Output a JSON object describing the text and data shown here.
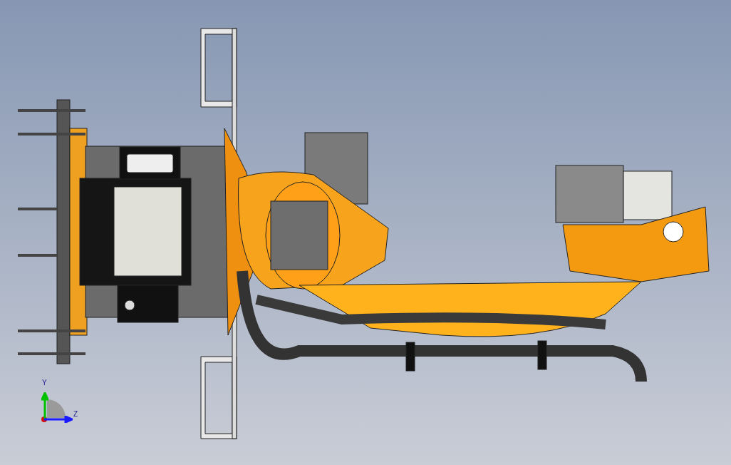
{
  "viewport": {
    "triad": {
      "axes": [
        {
          "label": "Y",
          "kind": "vertical",
          "color": "#00c000"
        },
        {
          "label": "Z",
          "kind": "horizontal",
          "color": "#1a1aff"
        }
      ]
    }
  }
}
